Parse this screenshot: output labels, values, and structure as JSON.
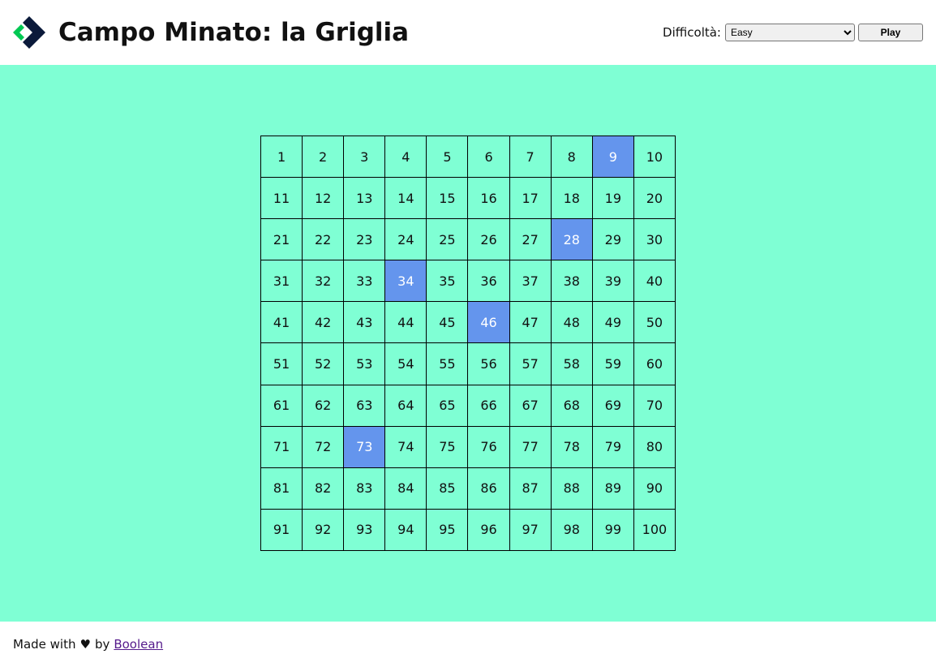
{
  "header": {
    "title": "Campo Minato: la Griglia",
    "difficulty_label": "Difficoltà:",
    "difficulty_selected": "Easy",
    "play_label": "Play"
  },
  "grid": {
    "cells": [
      "1",
      "2",
      "3",
      "4",
      "5",
      "6",
      "7",
      "8",
      "9",
      "10",
      "11",
      "12",
      "13",
      "14",
      "15",
      "16",
      "17",
      "18",
      "19",
      "20",
      "21",
      "22",
      "23",
      "24",
      "25",
      "26",
      "27",
      "28",
      "29",
      "30",
      "31",
      "32",
      "33",
      "34",
      "35",
      "36",
      "37",
      "38",
      "39",
      "40",
      "41",
      "42",
      "43",
      "44",
      "45",
      "46",
      "47",
      "48",
      "49",
      "50",
      "51",
      "52",
      "53",
      "54",
      "55",
      "56",
      "57",
      "58",
      "59",
      "60",
      "61",
      "62",
      "63",
      "64",
      "65",
      "66",
      "67",
      "68",
      "69",
      "70",
      "71",
      "72",
      "73",
      "74",
      "75",
      "76",
      "77",
      "78",
      "79",
      "80",
      "81",
      "82",
      "83",
      "84",
      "85",
      "86",
      "87",
      "88",
      "89",
      "90",
      "91",
      "92",
      "93",
      "94",
      "95",
      "96",
      "97",
      "98",
      "99",
      "100"
    ],
    "highlighted": [
      "9",
      "28",
      "34",
      "46",
      "73"
    ]
  },
  "footer": {
    "made_with": "Made with",
    "heart": "♥",
    "by": "by",
    "link": "Boolean"
  },
  "colors": {
    "background": "#7fffd4",
    "highlight": "#6495ed",
    "logo_dark": "#0b1a3a",
    "logo_green": "#00c853"
  }
}
